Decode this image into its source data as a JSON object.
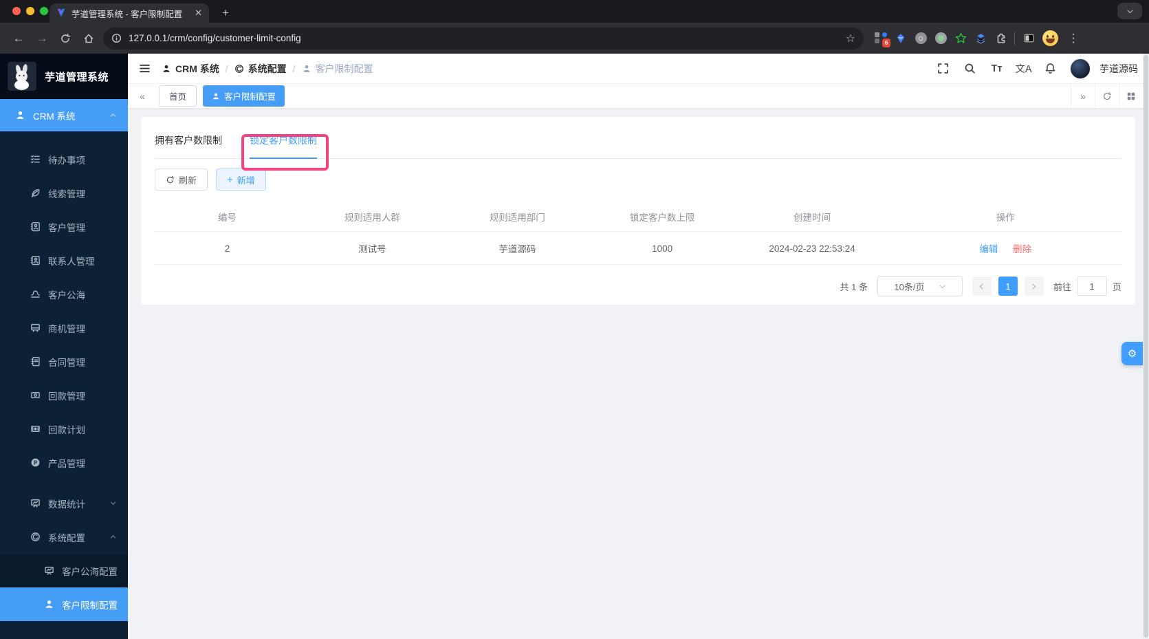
{
  "browser": {
    "tab_title": "芋道管理系统 - 客户限制配置",
    "url": "127.0.0.1/crm/config/customer-limit-config",
    "extension_badge": "6"
  },
  "icons": {
    "back": "←",
    "forward": "→",
    "plus": "+",
    "star": "☆",
    "kebab": "⋮",
    "close": "✕",
    "chevrons_left": "«",
    "chevrons_right": "»",
    "font_size": "Tт",
    "language": "文A",
    "gear": "⚙"
  },
  "app_header": {
    "breadcrumb": {
      "separator": "/",
      "items": [
        "CRM 系统",
        "系统配置",
        "客户限制配置"
      ]
    },
    "username": "芋道源码"
  },
  "sidebar": {
    "logo_title": "芋道管理系统",
    "items": [
      "CRM 系统",
      "待办事项",
      "线索管理",
      "客户管理",
      "联系人管理",
      "客户公海",
      "商机管理",
      "合同管理",
      "回款管理",
      "回款计划",
      "产品管理",
      "数据统计",
      "系统配置",
      "客户公海配置",
      "客户限制配置"
    ]
  },
  "tagbar": {
    "tabs": [
      "首页",
      "客户限制配置"
    ]
  },
  "content": {
    "tabs": [
      "拥有客户数限制",
      "锁定客户数限制"
    ],
    "refresh_label": "刷新",
    "add_label": "新增",
    "table": {
      "headers": [
        "编号",
        "规则适用人群",
        "规则适用部门",
        "锁定客户数上限",
        "创建时间",
        "操作"
      ],
      "row": {
        "id": "2",
        "group": "测试号",
        "dept": "芋道源码",
        "limit": "1000",
        "created": "2024-02-23 22:53:24",
        "edit": "编辑",
        "delete": "删除"
      }
    },
    "pagination": {
      "total": "共 1 条",
      "page_size": "10条/页",
      "current": "1",
      "goto_label": "前往",
      "goto_value": "1",
      "unit": "页"
    }
  },
  "colors": {
    "accent": "#409eff",
    "menu_active": "#459df5",
    "danger": "#f56c6c",
    "annotation": "#f2427f",
    "sidebar_bg": "#0c2135"
  }
}
